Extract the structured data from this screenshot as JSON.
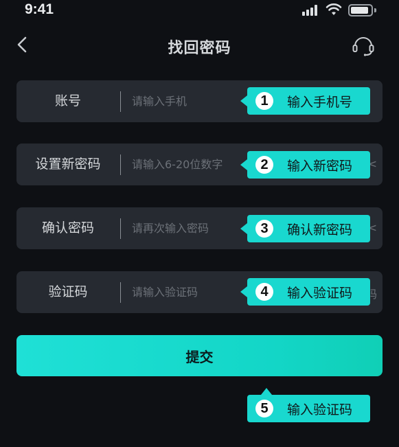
{
  "status_bar": {
    "time": "9:41"
  },
  "header": {
    "title": "找回密码"
  },
  "fields": [
    {
      "label": "账号",
      "placeholder": "请输入手机",
      "edge": ""
    },
    {
      "label": "设置新密码",
      "placeholder": "请输入6-20位数字",
      "edge": "<"
    },
    {
      "label": "确认密码",
      "placeholder": "请再次输入密码",
      "edge": "<"
    },
    {
      "label": "验证码",
      "placeholder": "请输入验证码",
      "edge": "码"
    }
  ],
  "submit_label": "提交",
  "callouts": [
    {
      "number": "1",
      "text": "输入手机号"
    },
    {
      "number": "2",
      "text": "输入新密码"
    },
    {
      "number": "3",
      "text": "确认新密码"
    },
    {
      "number": "4",
      "text": "输入验证码"
    },
    {
      "number": "5",
      "text": "输入验证码"
    }
  ],
  "colors": {
    "accent": "#19d8cf",
    "background": "#0e1014",
    "field_bg": "#262a31"
  },
  "icons": {
    "back": "chevron-left-icon",
    "support": "headset-icon"
  }
}
